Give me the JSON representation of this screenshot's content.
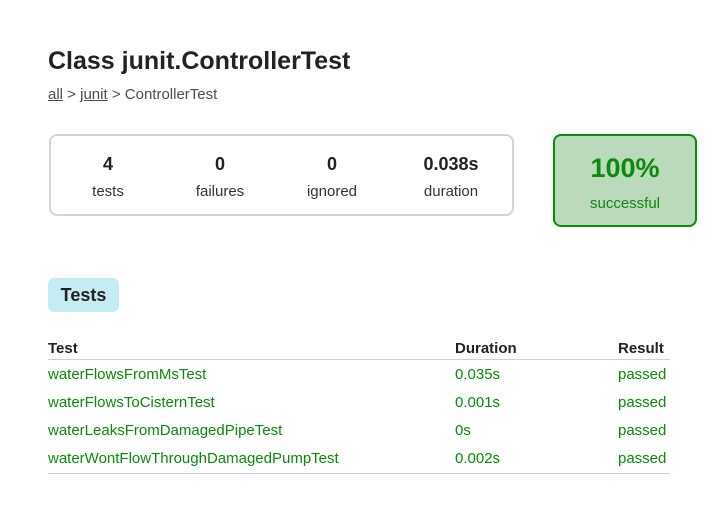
{
  "page": {
    "title": "Class junit.ControllerTest"
  },
  "breadcrumb": {
    "all": "all",
    "sep1": " > ",
    "package": "junit",
    "sep2": " > ",
    "current": "ControllerTest"
  },
  "summary": {
    "tests": {
      "value": "4",
      "label": "tests"
    },
    "failures": {
      "value": "0",
      "label": "failures"
    },
    "ignored": {
      "value": "0",
      "label": "ignored"
    },
    "duration": {
      "value": "0.038s",
      "label": "duration"
    }
  },
  "success": {
    "percent": "100%",
    "label": "successful",
    "color": "#0b8a0b",
    "background": "#bbd9bb"
  },
  "tabs": {
    "tests_label": "Tests",
    "background": "#c6ecf3"
  },
  "table": {
    "headers": {
      "test": "Test",
      "duration": "Duration",
      "result": "Result"
    },
    "rows": [
      {
        "test": "waterFlowsFromMsTest",
        "duration": "0.035s",
        "result": "passed"
      },
      {
        "test": "waterFlowsToCisternTest",
        "duration": "0.001s",
        "result": "passed"
      },
      {
        "test": "waterLeaksFromDamagedPipeTest",
        "duration": "0s",
        "result": "passed"
      },
      {
        "test": "waterWontFlowThroughDamagedPumpTest",
        "duration": "0.002s",
        "result": "passed"
      }
    ],
    "pass_color": "#0b8a0b"
  }
}
